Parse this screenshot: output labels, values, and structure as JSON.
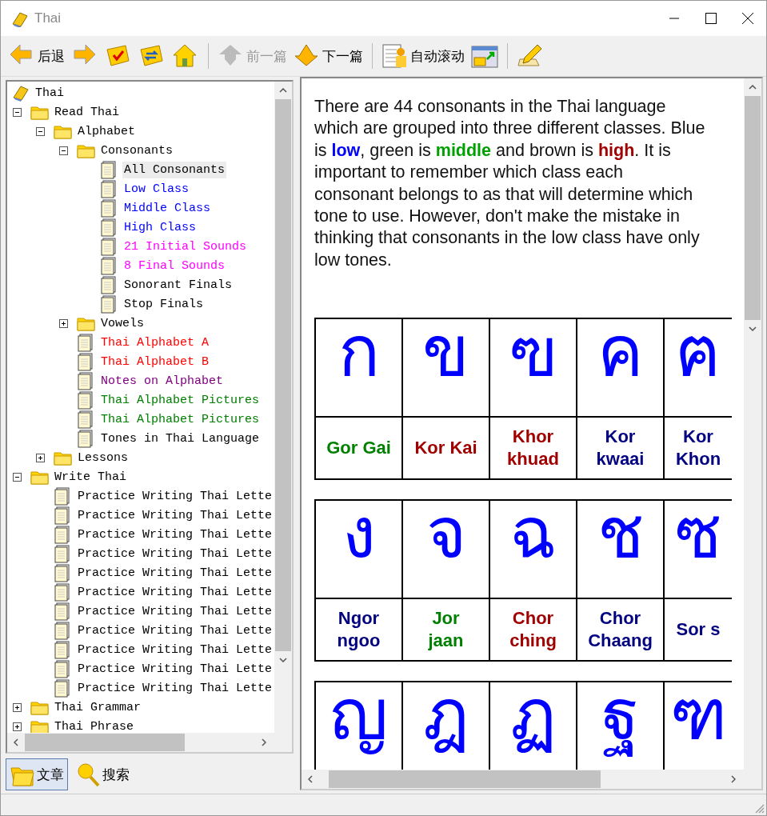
{
  "window": {
    "title": "Thai"
  },
  "toolbar": [
    {
      "kind": "back",
      "label": "后退",
      "disabled": false
    },
    {
      "kind": "forward",
      "disabled": false
    },
    {
      "kind": "check",
      "disabled": false
    },
    {
      "kind": "sync",
      "disabled": false
    },
    {
      "kind": "home",
      "disabled": false
    },
    {
      "kind": "prev",
      "label": "前一篇",
      "disabled": true
    },
    {
      "kind": "next",
      "label": "下一篇",
      "disabled": false
    },
    {
      "kind": "autoscroll",
      "label": "自动滚动",
      "disabled": false
    },
    {
      "kind": "window",
      "disabled": false
    },
    {
      "kind": "edit",
      "disabled": false
    }
  ],
  "tree": {
    "label": "Thai",
    "kind": "book",
    "children": [
      {
        "label": "Read Thai",
        "kind": "folder",
        "expanded": true,
        "children": [
          {
            "label": "Alphabet",
            "kind": "folder",
            "expanded": true,
            "children": [
              {
                "label": "Consonants",
                "kind": "folder",
                "expanded": true,
                "children": [
                  {
                    "label": "All Consonants",
                    "kind": "page",
                    "selected": true,
                    "color": "#000000"
                  },
                  {
                    "label": "Low Class",
                    "kind": "page",
                    "selected": false,
                    "color": "#0000ff"
                  },
                  {
                    "label": "Middle Class",
                    "kind": "page",
                    "selected": false,
                    "color": "#0000ff"
                  },
                  {
                    "label": "High Class",
                    "kind": "page",
                    "selected": false,
                    "color": "#0000ff"
                  },
                  {
                    "label": "21 Initial Sounds",
                    "kind": "page",
                    "selected": false,
                    "color": "#ff00ff"
                  },
                  {
                    "label": "8 Final Sounds",
                    "kind": "page",
                    "selected": false,
                    "color": "#ff00ff"
                  },
                  {
                    "label": "Sonorant Finals",
                    "kind": "page",
                    "selected": false,
                    "color": "#000000"
                  },
                  {
                    "label": "Stop Finals",
                    "kind": "page",
                    "selected": false,
                    "color": "#000000"
                  }
                ]
              },
              {
                "label": "Vowels",
                "kind": "folder",
                "expanded": false
              },
              {
                "label": "Thai Alphabet A",
                "kind": "page",
                "selected": false,
                "color": "#ff0000"
              },
              {
                "label": "Thai Alphabet B",
                "kind": "page",
                "selected": false,
                "color": "#ff0000"
              },
              {
                "label": "Notes on Alphabet",
                "kind": "page",
                "selected": false,
                "color": "#800080"
              },
              {
                "label": "Thai Alphabet Pictures",
                "kind": "page",
                "selected": false,
                "color": "#008000"
              },
              {
                "label": "Thai Alphabet Pictures",
                "kind": "page",
                "selected": false,
                "color": "#008000"
              },
              {
                "label": "Tones in Thai Language",
                "kind": "page",
                "selected": false,
                "color": "#000000"
              }
            ]
          },
          {
            "label": "Lessons",
            "kind": "folder",
            "expanded": false
          }
        ]
      },
      {
        "label": "Write Thai",
        "kind": "folder",
        "expanded": true,
        "children": [
          {
            "label": "Practice Writing Thai Lette",
            "kind": "page",
            "selected": false,
            "color": "#000000"
          },
          {
            "label": "Practice Writing Thai Lette",
            "kind": "page",
            "selected": false,
            "color": "#000000"
          },
          {
            "label": "Practice Writing Thai Lette",
            "kind": "page",
            "selected": false,
            "color": "#000000"
          },
          {
            "label": "Practice Writing Thai Lette",
            "kind": "page",
            "selected": false,
            "color": "#000000"
          },
          {
            "label": "Practice Writing Thai Lette",
            "kind": "page",
            "selected": false,
            "color": "#000000"
          },
          {
            "label": "Practice Writing Thai Lette",
            "kind": "page",
            "selected": false,
            "color": "#000000"
          },
          {
            "label": "Practice Writing Thai Lette",
            "kind": "page",
            "selected": false,
            "color": "#000000"
          },
          {
            "label": "Practice Writing Thai Lette",
            "kind": "page",
            "selected": false,
            "color": "#000000"
          },
          {
            "label": "Practice Writing Thai Lette",
            "kind": "page",
            "selected": false,
            "color": "#000000"
          },
          {
            "label": "Practice Writing Thai Lette",
            "kind": "page",
            "selected": false,
            "color": "#000000"
          },
          {
            "label": "Practice Writing Thai Lette",
            "kind": "page",
            "selected": false,
            "color": "#000000"
          }
        ]
      },
      {
        "label": "Thai Grammar",
        "kind": "folder",
        "expanded": false
      },
      {
        "label": "Thai Phrase",
        "kind": "folder",
        "expanded": false
      }
    ]
  },
  "bottom_tabs": [
    {
      "kind": "articles",
      "label": "文章",
      "selected": true
    },
    {
      "kind": "search",
      "label": "搜索",
      "selected": false
    }
  ],
  "article": {
    "intro": [
      {
        "text": "There are 44 consonants in the Thai language which are grouped into three different classes. Blue is "
      },
      {
        "text": "low",
        "color": "#0000ff"
      },
      {
        "text": ", green is "
      },
      {
        "text": "middle",
        "color": "#00a000"
      },
      {
        "text": " and brown is "
      },
      {
        "text": "high",
        "color": "#a00000"
      },
      {
        "text": ". It is important to remember which class each consonant belongs to as that will determine which tone to use. However, don't make the mistake in thinking that consonants in the low class have only low tones."
      }
    ],
    "tables": [
      {
        "cells": [
          {
            "letter": "ก",
            "name": "Gor Gai",
            "color": "#008000"
          },
          {
            "letter": "ข",
            "name": "Kor Kai",
            "color": "#a00000"
          },
          {
            "letter": "ฃ",
            "name": "Khor\nkhuad",
            "color": "#a00000"
          },
          {
            "letter": "ค",
            "name": "Kor\nkwaai",
            "color": "#000080"
          },
          {
            "letter": "ฅ",
            "name": "Kor\nKhon",
            "color": "#000080"
          }
        ]
      },
      {
        "cells": [
          {
            "letter": "ง",
            "name": "Ngor\nngoo",
            "color": "#000080"
          },
          {
            "letter": "จ",
            "name": "Jor\njaan",
            "color": "#008000"
          },
          {
            "letter": "ฉ",
            "name": "Chor\nching",
            "color": "#a00000"
          },
          {
            "letter": "ช",
            "name": "Chor\nChaang",
            "color": "#000080"
          },
          {
            "letter": "ซ",
            "name": "Sor s",
            "color": "#000080"
          }
        ]
      },
      {
        "cells": [
          {
            "letter": "ญ"
          },
          {
            "letter": "ฎ"
          },
          {
            "letter": "ฏ"
          },
          {
            "letter": "ฐ"
          },
          {
            "letter": "ฑ"
          }
        ]
      }
    ]
  }
}
